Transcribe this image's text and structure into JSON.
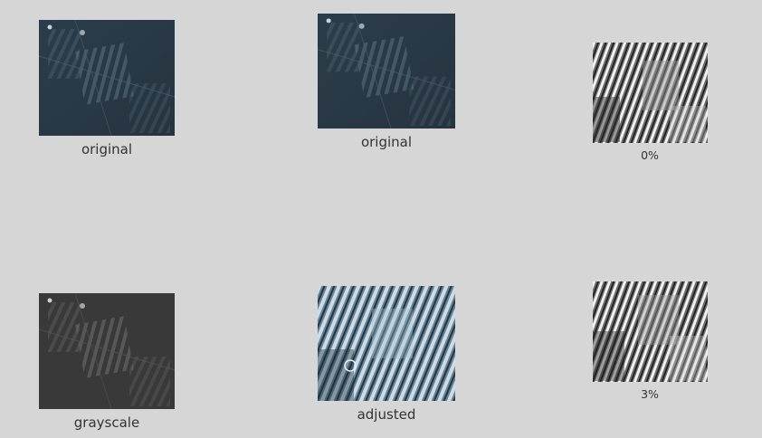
{
  "panels": [
    {
      "id": "p1",
      "caption": "original",
      "style": "blue"
    },
    {
      "id": "p2",
      "caption": "original",
      "style": "blue"
    },
    {
      "id": "p3",
      "caption": "0%",
      "style": "hicon"
    },
    {
      "id": "p4",
      "caption": "grayscale",
      "style": "gray"
    },
    {
      "id": "p5",
      "caption": "adjusted",
      "style": "adjusted"
    },
    {
      "id": "p6",
      "caption": "3%",
      "style": "hicon"
    }
  ],
  "colors": {
    "background": "#d6d6d6",
    "blue_dark": "#2a3a46",
    "blue_light": "#5c7282",
    "gray_dark": "#3a3a3a",
    "gray_light": "#7a7a7a"
  }
}
